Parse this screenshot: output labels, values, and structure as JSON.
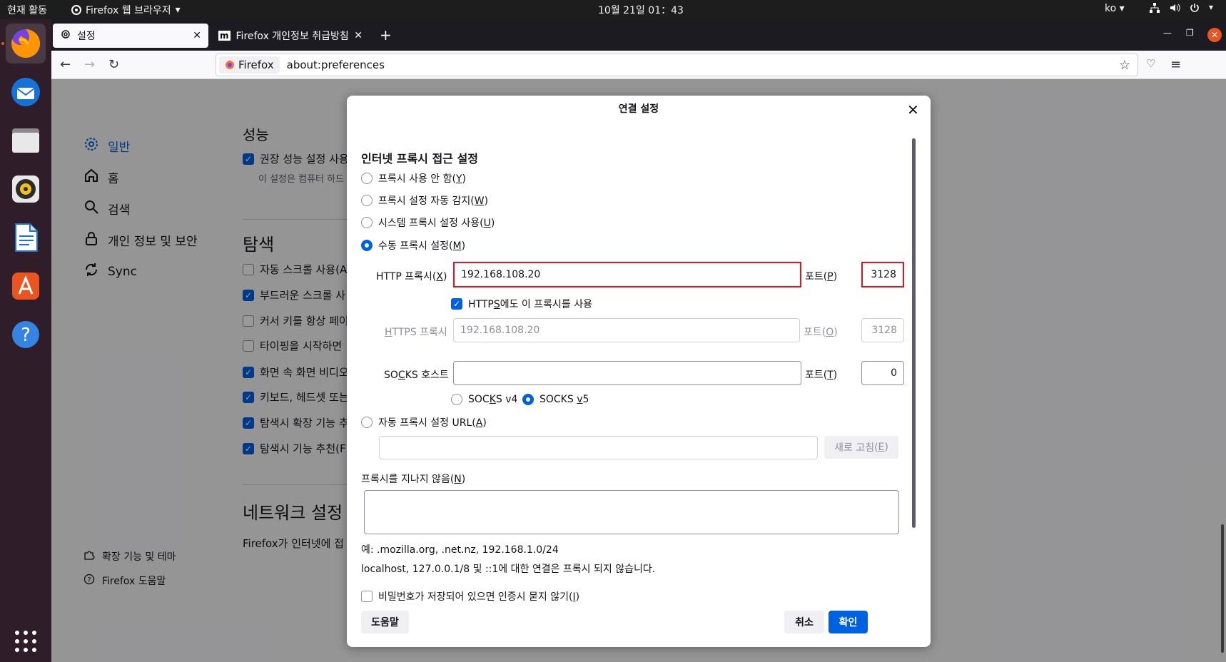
{
  "topbar": {
    "activities": "현재 활동",
    "app_name": "Firefox 웹 브라우저",
    "clock": "10월 21일  01：43",
    "lang": "ko"
  },
  "dock": {
    "items": [
      "firefox-icon",
      "thunderbird-icon",
      "files-icon",
      "rhythmbox-icon",
      "writer-icon",
      "app-center-icon",
      "help-icon",
      "show-apps-icon"
    ]
  },
  "tabs": [
    {
      "label": "설정",
      "active": true
    },
    {
      "label": "Firefox 개인정보 취급방침",
      "active": false
    }
  ],
  "urlbar": {
    "identity": "Firefox",
    "url": "about:preferences"
  },
  "sidebar": {
    "items": [
      {
        "label": "일반",
        "icon": "gear-icon",
        "selected": true
      },
      {
        "label": "홈",
        "icon": "home-icon"
      },
      {
        "label": "검색",
        "icon": "search-icon"
      },
      {
        "label": "개인 정보 및 보안",
        "icon": "lock-icon"
      },
      {
        "label": "Sync",
        "icon": "sync-icon"
      }
    ],
    "footer": [
      {
        "label": "확장 기능 및 테마",
        "icon": "puzzle-icon"
      },
      {
        "label": "Firefox 도움말",
        "icon": "help-circle-icon"
      }
    ]
  },
  "prefs": {
    "perf_heading": "성능",
    "perf_rows": [
      {
        "label": "권장 성능 설정 사용(U)",
        "checked": true
      },
      {
        "label": "이 설정은 컴퓨터 하드",
        "checked": null
      }
    ],
    "browse_heading": "탐색",
    "browse_rows": [
      {
        "label": "자동 스크롤 사용(A",
        "checked": false
      },
      {
        "label": "부드러운 스크롤 사",
        "checked": true
      },
      {
        "label": "커서 키를 항상 페이",
        "checked": false
      },
      {
        "label": "타이핑을 시작하면",
        "checked": false
      },
      {
        "label": "화면 속 화면 비디오",
        "checked": true
      },
      {
        "label": "키보드, 헤드셋 또는",
        "checked": true
      },
      {
        "label": "탐색시 확장 기능 추",
        "checked": true
      },
      {
        "label": "탐색시 기능 추천(F",
        "checked": true
      }
    ],
    "network_heading": "네트워크 설정",
    "network_desc": "Firefox가 인터넷에 접"
  },
  "dialog": {
    "title": "연결 설정",
    "heading": "인터넷 프록시 접근 설정",
    "options": {
      "no_proxy": {
        "text": "프록시 사용 안 함(",
        "key": "Y",
        "end": ")"
      },
      "auto_detect": {
        "text": "프록시 설정 자동 감지(",
        "key": "W",
        "end": ")"
      },
      "system": {
        "text": "시스템 프록시 설정 사용(",
        "key": "U",
        "end": ")"
      },
      "manual": {
        "text": "수동 프록시 설정(",
        "key": "M",
        "end": ")"
      }
    },
    "selected_option": "manual",
    "http_label": {
      "text": "HTTP 프록시(",
      "key": "X",
      "end": ")"
    },
    "http_value": "192.168.108.20",
    "http_port_label": {
      "text": "포트(",
      "key": "P",
      "end": ")"
    },
    "http_port": "3128",
    "use_for_https": {
      "pre": "HTTP",
      "key": "S",
      "post": "에도 이 프록시를 사용",
      "checked": true
    },
    "https_label": {
      "key": "H",
      "text": "TTPS 프록시"
    },
    "https_value": "192.168.108.20",
    "https_port_label": {
      "text": "포트(",
      "key": "O",
      "end": ")"
    },
    "https_port": "3128",
    "socks_label": {
      "pre": "SO",
      "key": "C",
      "post": "KS 호스트"
    },
    "socks_value": "",
    "socks_port_label": {
      "text": "포트(",
      "key": "T",
      "end": ")"
    },
    "socks_port": "0",
    "socks_v4": {
      "pre": "SOC",
      "key": "K",
      "post": "S v4"
    },
    "socks_v5": {
      "pre": "SOCKS ",
      "key": "v",
      "post": "5"
    },
    "socks_version": "v5",
    "auto_url": {
      "text": "자동 프록시 설정 URL(",
      "key": "A",
      "end": ")"
    },
    "auto_url_value": "",
    "reload": {
      "text": "새로 고침(",
      "key": "E",
      "end": ")"
    },
    "no_proxy_for": {
      "text": "프록시를 지나지 않음(",
      "key": "N",
      "end": ")"
    },
    "no_proxy_value": "",
    "example": "예: .mozilla.org, .net.nz, 192.168.1.0/24",
    "localhost_note": "localhost, 127.0.0.1/8 및 ::1에 대한 연결은 프록시 되지 않습니다.",
    "no_auth_prompt": {
      "text": "비밀번호가 저장되어 있으면 인증시 묻지 않기(",
      "key": "I",
      "end": ")",
      "checked": false
    },
    "help_btn": "도움말",
    "cancel_btn": "취소",
    "ok_btn": "확인"
  },
  "colors": {
    "accent": "#0061e0",
    "highlight": "#e0131f",
    "dock_bg": "#2f1e2a",
    "ubuntu_orange": "#e95420"
  }
}
